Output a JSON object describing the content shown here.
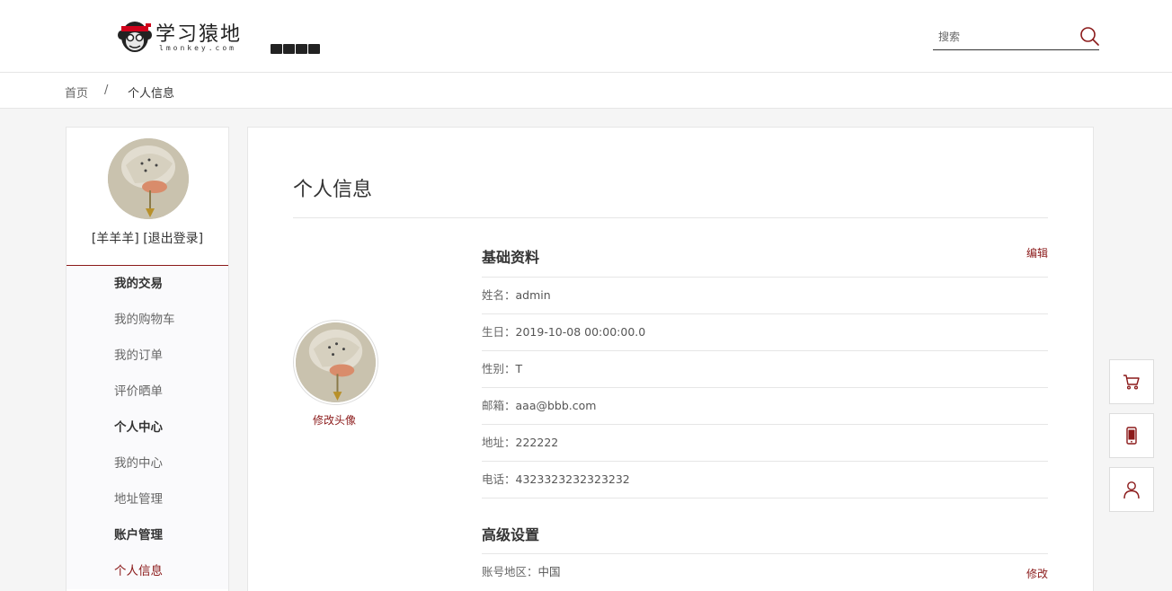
{
  "header": {
    "logo_title": "学习猿地",
    "logo_url": "lmonkey.com",
    "search_placeholder": "搜索"
  },
  "breadcrumb": {
    "home": "首页",
    "separator": "/",
    "current": "个人信息"
  },
  "sidebar": {
    "username": "[羊羊羊]",
    "logout": "[退出登录]",
    "items": [
      {
        "label": "我的交易",
        "type": "group"
      },
      {
        "label": "我的购物车",
        "type": "link"
      },
      {
        "label": "我的订单",
        "type": "link"
      },
      {
        "label": "评价晒单",
        "type": "link"
      },
      {
        "label": "个人中心",
        "type": "group"
      },
      {
        "label": "我的中心",
        "type": "link"
      },
      {
        "label": "地址管理",
        "type": "link"
      },
      {
        "label": "账户管理",
        "type": "group"
      },
      {
        "label": "个人信息",
        "type": "active"
      }
    ]
  },
  "main": {
    "title": "个人信息",
    "change_avatar": "修改头像",
    "basic": {
      "title": "基础资料",
      "edit": "编辑",
      "name": {
        "label": "姓名：",
        "value": "admin"
      },
      "birthday": {
        "label": "生日：",
        "value": "2019-10-08 00:00:00.0"
      },
      "gender": {
        "label": "性别：",
        "value": "T"
      },
      "email": {
        "label": "邮箱：",
        "value": "aaa@bbb.com"
      },
      "address": {
        "label": "地址：",
        "value": "222222"
      },
      "phone": {
        "label": "电话：",
        "value": "4323323232323232"
      }
    },
    "advanced": {
      "title": "高级设置",
      "region": {
        "label": "账号地区：",
        "value": "中国"
      },
      "modify": "修改"
    }
  },
  "float_buttons": [
    "cart-icon",
    "phone-icon",
    "user-icon"
  ],
  "colors": {
    "accent": "#8b1a1a",
    "background": "#f5f5f5"
  }
}
